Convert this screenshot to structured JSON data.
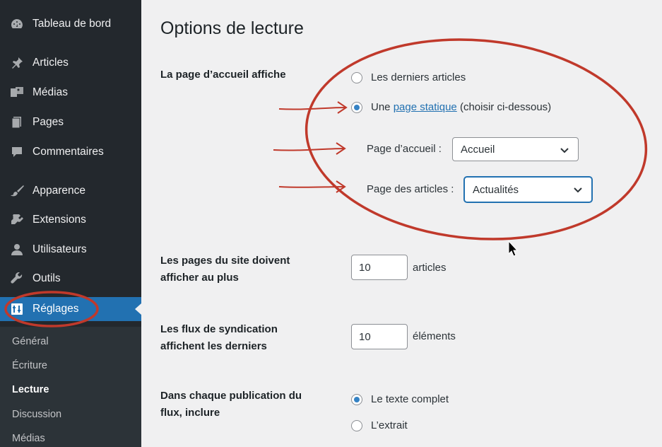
{
  "sidebar": {
    "items": [
      {
        "label": "Tableau de bord",
        "icon": "dashboard-icon"
      },
      {
        "label": "Articles",
        "icon": "pin-icon"
      },
      {
        "label": "Médias",
        "icon": "media-icon"
      },
      {
        "label": "Pages",
        "icon": "pages-icon"
      },
      {
        "label": "Commentaires",
        "icon": "comment-icon"
      },
      {
        "label": "Apparence",
        "icon": "brush-icon"
      },
      {
        "label": "Extensions",
        "icon": "plugin-icon"
      },
      {
        "label": "Utilisateurs",
        "icon": "user-icon"
      },
      {
        "label": "Outils",
        "icon": "wrench-icon"
      },
      {
        "label": "Réglages",
        "icon": "settings-icon"
      }
    ],
    "submenu": [
      "Général",
      "Écriture",
      "Lecture",
      "Discussion",
      "Médias"
    ]
  },
  "main": {
    "title": "Options de lecture",
    "homepage": {
      "label": "La page d’accueil affiche",
      "opt_latest": "Les derniers articles",
      "opt_static_prefix": "Une",
      "opt_static_link": "page statique",
      "opt_static_suffix": "(choisir ci-dessous)",
      "front_label": "Page d’accueil :",
      "front_value": "Accueil",
      "posts_label": "Page des articles :",
      "posts_value": "Actualités"
    },
    "per_page": {
      "label_1": "Les pages du site doivent",
      "label_2": "afficher au plus",
      "value": "10",
      "suffix": "articles"
    },
    "feed": {
      "label_1": "Les flux de syndication",
      "label_2": "affichent les derniers",
      "value": "10",
      "suffix": "éléments"
    },
    "feed_content": {
      "label_1": "Dans chaque publication du",
      "label_2": "flux, inclure",
      "opt_full": "Le texte complet",
      "opt_excerpt": "L’extrait"
    }
  }
}
